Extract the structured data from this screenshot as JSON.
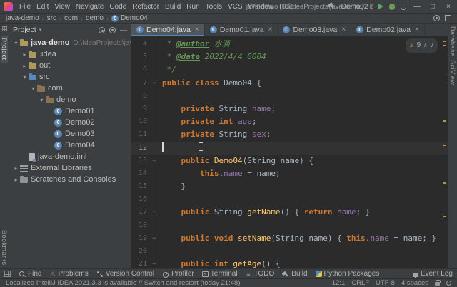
{
  "icons": {
    "chevron_down": "▾",
    "chevron_right": "▸",
    "close": "×",
    "warning": "⚠",
    "up": "∧",
    "down": "∨",
    "minimize": "—",
    "maximize": "□",
    "close_window": "×",
    "separator": "›",
    "hide": "—"
  },
  "glyph_icons": {
    "warn": "⚠",
    "todo": "≡"
  },
  "title_bar": {
    "menus": [
      "File",
      "Edit",
      "View",
      "Navigate",
      "Code",
      "Refactor",
      "Build",
      "Run",
      "Tools",
      "VCS",
      "Window",
      "Help"
    ],
    "title": "java-demo [D:\\IdeaProjects\\java-demo] - Demo04.java",
    "run_config": "Demo02"
  },
  "breadcrumbs": [
    {
      "label": "java-demo"
    },
    {
      "label": "src"
    },
    {
      "label": "com"
    },
    {
      "label": "demo"
    },
    {
      "label": "Demo04",
      "icon": "class"
    }
  ],
  "left_stripe": {
    "top": [
      "Project"
    ],
    "bottom": [
      "Bookmarks"
    ]
  },
  "right_stripe": {
    "top": [
      "Database",
      "SciView"
    ],
    "bottom": []
  },
  "project_panel": {
    "title": "Project",
    "tree": [
      {
        "label": "java-demo",
        "hint": "D:\\IdeaProjects\\java-demo",
        "icon": "folder",
        "indent": 0,
        "chevron": "down",
        "bold": true
      },
      {
        "label": ".idea",
        "icon": "folder",
        "indent": 1,
        "chevron": "right"
      },
      {
        "label": "out",
        "icon": "folder",
        "indent": 1,
        "chevron": "right"
      },
      {
        "label": "src",
        "icon": "src",
        "indent": 1,
        "chevron": "down"
      },
      {
        "label": "com",
        "icon": "package",
        "indent": 2,
        "chevron": "down"
      },
      {
        "label": "demo",
        "icon": "package",
        "indent": 3,
        "chevron": "down"
      },
      {
        "label": "Demo01",
        "icon": "class",
        "indent": 4
      },
      {
        "label": "Demo02",
        "icon": "class",
        "indent": 4
      },
      {
        "label": "Demo03",
        "icon": "class",
        "indent": 4
      },
      {
        "label": "Demo04",
        "icon": "class",
        "indent": 4
      },
      {
        "label": "java-demo.iml",
        "icon": "iml",
        "indent": 1
      },
      {
        "label": "External Libraries",
        "icon": "lib",
        "indent": 0,
        "chevron": "right"
      },
      {
        "label": "Scratches and Consoles",
        "icon": "scratch",
        "indent": 0,
        "chevron": "right"
      }
    ]
  },
  "tabs": [
    {
      "label": "Demo04.java",
      "active": true
    },
    {
      "label": "Demo01.java",
      "active": false
    },
    {
      "label": "Demo03.java",
      "active": false
    },
    {
      "label": "Demo02.java",
      "active": false
    }
  ],
  "editor": {
    "inspection": {
      "warnings": "9"
    },
    "lines": [
      {
        "no": 4,
        "tokens": [
          [
            "doc",
            " * "
          ],
          [
            "tag",
            "@author"
          ],
          [
            "doc",
            " 水滴"
          ]
        ]
      },
      {
        "no": 5,
        "tokens": [
          [
            "doc",
            " * "
          ],
          [
            "tag",
            "@date"
          ],
          [
            "doc",
            " 2022/4/4 0004"
          ]
        ]
      },
      {
        "no": 6,
        "tokens": [
          [
            "doc",
            " */"
          ]
        ]
      },
      {
        "no": 7,
        "fold": "−",
        "tokens": [
          [
            "kw",
            "public class "
          ],
          [
            "pln",
            "Demo04 {"
          ]
        ]
      },
      {
        "no": 8,
        "tokens": []
      },
      {
        "no": 9,
        "tokens": [
          [
            "pln",
            "    "
          ],
          [
            "kw",
            "private "
          ],
          [
            "pln",
            "String "
          ],
          [
            "fld",
            "name"
          ],
          [
            "pln",
            ";"
          ]
        ]
      },
      {
        "no": 10,
        "tokens": [
          [
            "pln",
            "    "
          ],
          [
            "kw",
            "private int "
          ],
          [
            "fld",
            "age"
          ],
          [
            "pln",
            ";"
          ]
        ]
      },
      {
        "no": 11,
        "tokens": [
          [
            "pln",
            "    "
          ],
          [
            "kw",
            "private "
          ],
          [
            "pln",
            "String "
          ],
          [
            "fld",
            "sex"
          ],
          [
            "pln",
            ";"
          ]
        ]
      },
      {
        "no": 12,
        "cur": true,
        "caret": true,
        "tokens": []
      },
      {
        "no": 13,
        "fold": "−",
        "tokens": [
          [
            "pln",
            "    "
          ],
          [
            "kw",
            "public "
          ],
          [
            "mtd",
            "Demo04"
          ],
          [
            "pln",
            "(String name) {"
          ]
        ]
      },
      {
        "no": 14,
        "tokens": [
          [
            "pln",
            "        "
          ],
          [
            "kw",
            "this"
          ],
          [
            "pln",
            "."
          ],
          [
            "fld",
            "name"
          ],
          [
            "pln",
            " = name;"
          ]
        ]
      },
      {
        "no": 15,
        "tokens": [
          [
            "pln",
            "    }"
          ]
        ]
      },
      {
        "no": 16,
        "tokens": []
      },
      {
        "no": 17,
        "fold": "−",
        "tokens": [
          [
            "pln",
            "    "
          ],
          [
            "kw",
            "public "
          ],
          [
            "pln",
            "String "
          ],
          [
            "mtd",
            "getName"
          ],
          [
            "pln",
            "() { "
          ],
          [
            "kw",
            "return "
          ],
          [
            "fld",
            "name"
          ],
          [
            "pln",
            "; }"
          ]
        ]
      },
      {
        "no": 18,
        "tokens": []
      },
      {
        "no": 19,
        "fold": "−",
        "tokens": [
          [
            "pln",
            "    "
          ],
          [
            "kw",
            "public void "
          ],
          [
            "mtd",
            "setName"
          ],
          [
            "pln",
            "(String name) { "
          ],
          [
            "kw",
            "this"
          ],
          [
            "pln",
            "."
          ],
          [
            "fld",
            "name"
          ],
          [
            "pln",
            " = name; }"
          ]
        ]
      },
      {
        "no": 20,
        "tokens": []
      },
      {
        "no": 21,
        "fold": "−",
        "tokens": [
          [
            "pln",
            "    "
          ],
          [
            "kw",
            "public int "
          ],
          [
            "mtd",
            "getAge"
          ],
          [
            "pln",
            "() {"
          ]
        ]
      }
    ]
  },
  "bottom_bar": {
    "left": [
      {
        "label": "Find",
        "icon": "search"
      },
      {
        "label": "Problems",
        "icon": "warn"
      },
      {
        "label": "Version Control",
        "icon": "vcs"
      },
      {
        "label": "Profiler",
        "icon": "profiler"
      },
      {
        "label": "Terminal",
        "icon": "terminal"
      },
      {
        "label": "TODO",
        "icon": "todo"
      },
      {
        "label": "Build",
        "icon": "build"
      },
      {
        "label": "Python Packages",
        "icon": "python"
      }
    ],
    "right": [
      {
        "label": "Event Log",
        "icon": "bell"
      }
    ]
  },
  "status_bar": {
    "message": "Localized IntelliJ IDEA 2021.3.3 is available // Switch and restart (today 21:48)",
    "items": [
      "12:1",
      "CRLF",
      "UTF-8",
      "4 spaces"
    ]
  }
}
